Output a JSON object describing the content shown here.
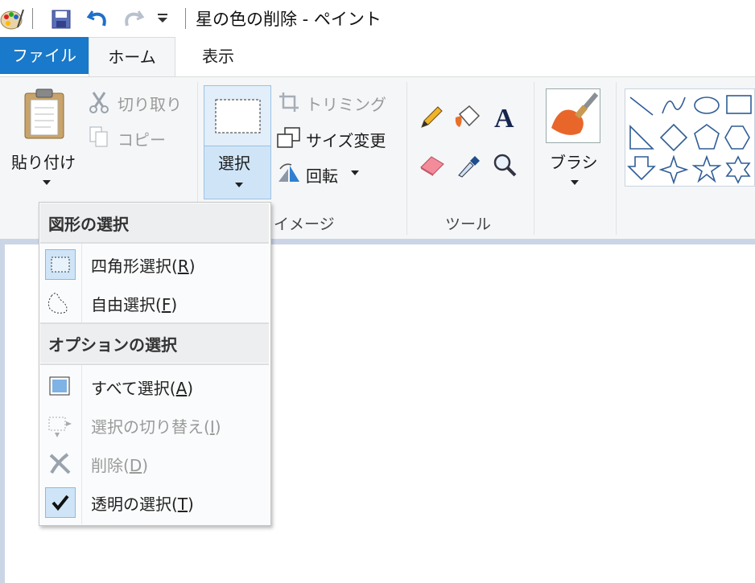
{
  "window": {
    "title": "星の色の削除 - ペイント"
  },
  "quick_access": {
    "icons": [
      "paint-app-icon",
      "save-icon",
      "undo-icon",
      "redo-icon",
      "customize-dropdown-icon"
    ]
  },
  "tabs": {
    "file": "ファイル",
    "home": "ホーム",
    "view": "表示"
  },
  "ribbon": {
    "clipboard": {
      "paste": "貼り付け",
      "cut": "切り取り",
      "copy": "コピー"
    },
    "image": {
      "select": "選択",
      "crop": "トリミング",
      "resize": "サイズ変更",
      "rotate": "回転",
      "group_label": "イメージ"
    },
    "tools": {
      "group_label": "ツール"
    },
    "brushes": {
      "label": "ブラシ"
    },
    "shapes": {
      "icons": [
        "line",
        "curve",
        "oval",
        "rectangle",
        "right-triangle",
        "diamond",
        "pentagon",
        "hexagon",
        "arrow-down",
        "four-point-star",
        "five-point-star",
        "six-point-star"
      ]
    }
  },
  "select_menu": {
    "shape_header": "図形の選択",
    "rect_pre": "四角形選択(",
    "rect_key": "R",
    "rect_post": ")",
    "free_pre": "自由選択(",
    "free_key": "F",
    "free_post": ")",
    "options_header": "オプションの選択",
    "all_pre": "すべて選択(",
    "all_key": "A",
    "all_post": ")",
    "invert_pre": "選択の切り替え(",
    "invert_key": "I",
    "invert_post": ")",
    "delete_pre": "削除(",
    "delete_key": "D",
    "delete_post": ")",
    "transparent_pre": "透明の選択(",
    "transparent_key": "T",
    "transparent_post": ")"
  },
  "colors": {
    "file_tab": "#1979ca",
    "selected_bg": "#cfe5f7",
    "canvas_border": "#cad5e6"
  }
}
